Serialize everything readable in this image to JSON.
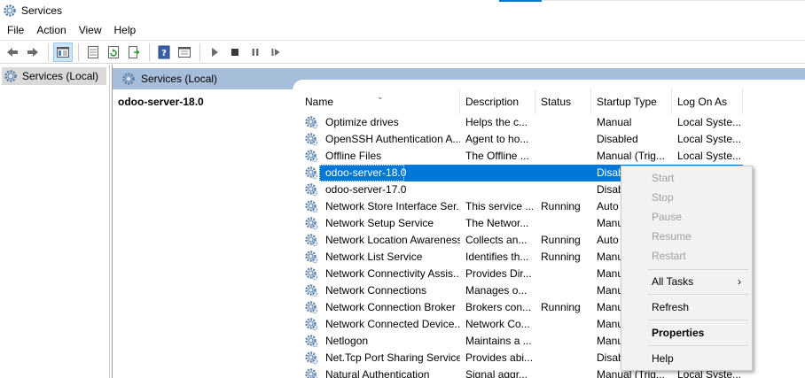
{
  "window": {
    "title": "Services"
  },
  "menu": {
    "file": "File",
    "action": "Action",
    "view": "View",
    "help": "Help"
  },
  "icons": {
    "back": "arrow-left-icon",
    "forward": "arrow-right-icon",
    "show_hide_tree": "console-tree-icon",
    "export": "export-list-icon",
    "refresh": "refresh-icon",
    "export2": "export-icon",
    "help": "help-icon",
    "properties_view": "properties-icon",
    "start": "play-icon",
    "stop": "stop-icon",
    "pause": "pause-icon",
    "resume": "resume-icon",
    "service": "gear-icon"
  },
  "colors": {
    "selected_row": "#0078d7",
    "header_band": "#a6bed9",
    "tree_selected": "#d9d9d9"
  },
  "tree": {
    "root_label": "Services (Local)"
  },
  "panel": {
    "header_label": "Services (Local)",
    "detail_title": "odoo-server-18.0"
  },
  "columns": {
    "name": "Name",
    "description": "Description",
    "status": "Status",
    "startup": "Startup Type",
    "logon": "Log On As"
  },
  "services": [
    {
      "name": "Optimize drives",
      "description": "Helps the c...",
      "status": "",
      "startup": "Manual",
      "logon": "Local Syste..."
    },
    {
      "name": "OpenSSH Authentication A...",
      "description": "Agent to ho...",
      "status": "",
      "startup": "Disabled",
      "logon": "Local Syste..."
    },
    {
      "name": "Offline Files",
      "description": "The Offline ...",
      "status": "",
      "startup": "Manual (Trig...",
      "logon": "Local Syste..."
    },
    {
      "name": "odoo-server-18.0",
      "description": "",
      "status": "",
      "startup": "Disab",
      "logon": ""
    },
    {
      "name": "odoo-server-17.0",
      "description": "",
      "status": "",
      "startup": "Disab",
      "logon": ""
    },
    {
      "name": "Network Store Interface Ser...",
      "description": "This service ...",
      "status": "Running",
      "startup": "Auto",
      "logon": ""
    },
    {
      "name": "Network Setup Service",
      "description": "The Networ...",
      "status": "",
      "startup": "Manu",
      "logon": ""
    },
    {
      "name": "Network Location Awareness",
      "description": "Collects an...",
      "status": "Running",
      "startup": "Auto",
      "logon": ""
    },
    {
      "name": "Network List Service",
      "description": "Identifies th...",
      "status": "Running",
      "startup": "Manu",
      "logon": ""
    },
    {
      "name": "Network Connectivity Assis...",
      "description": "Provides Dir...",
      "status": "",
      "startup": "Manu",
      "logon": ""
    },
    {
      "name": "Network Connections",
      "description": "Manages o...",
      "status": "",
      "startup": "Manu",
      "logon": ""
    },
    {
      "name": "Network Connection Broker",
      "description": "Brokers con...",
      "status": "Running",
      "startup": "Manu",
      "logon": ""
    },
    {
      "name": "Network Connected Device...",
      "description": "Network Co...",
      "status": "",
      "startup": "Manu",
      "logon": ""
    },
    {
      "name": "Netlogon",
      "description": "Maintains a ...",
      "status": "",
      "startup": "Manu",
      "logon": ""
    },
    {
      "name": "Net.Tcp Port Sharing Service",
      "description": "Provides abi...",
      "status": "",
      "startup": "Disab",
      "logon": ""
    },
    {
      "name": "Natural Authentication",
      "description": "Signal aggr...",
      "status": "",
      "startup": "Manual (Trig...",
      "logon": "Local Syste..."
    }
  ],
  "context_menu": {
    "start": "Start",
    "stop": "Stop",
    "pause": "Pause",
    "resume": "Resume",
    "restart": "Restart",
    "all_tasks": "All Tasks",
    "refresh": "Refresh",
    "properties": "Properties",
    "help": "Help"
  }
}
